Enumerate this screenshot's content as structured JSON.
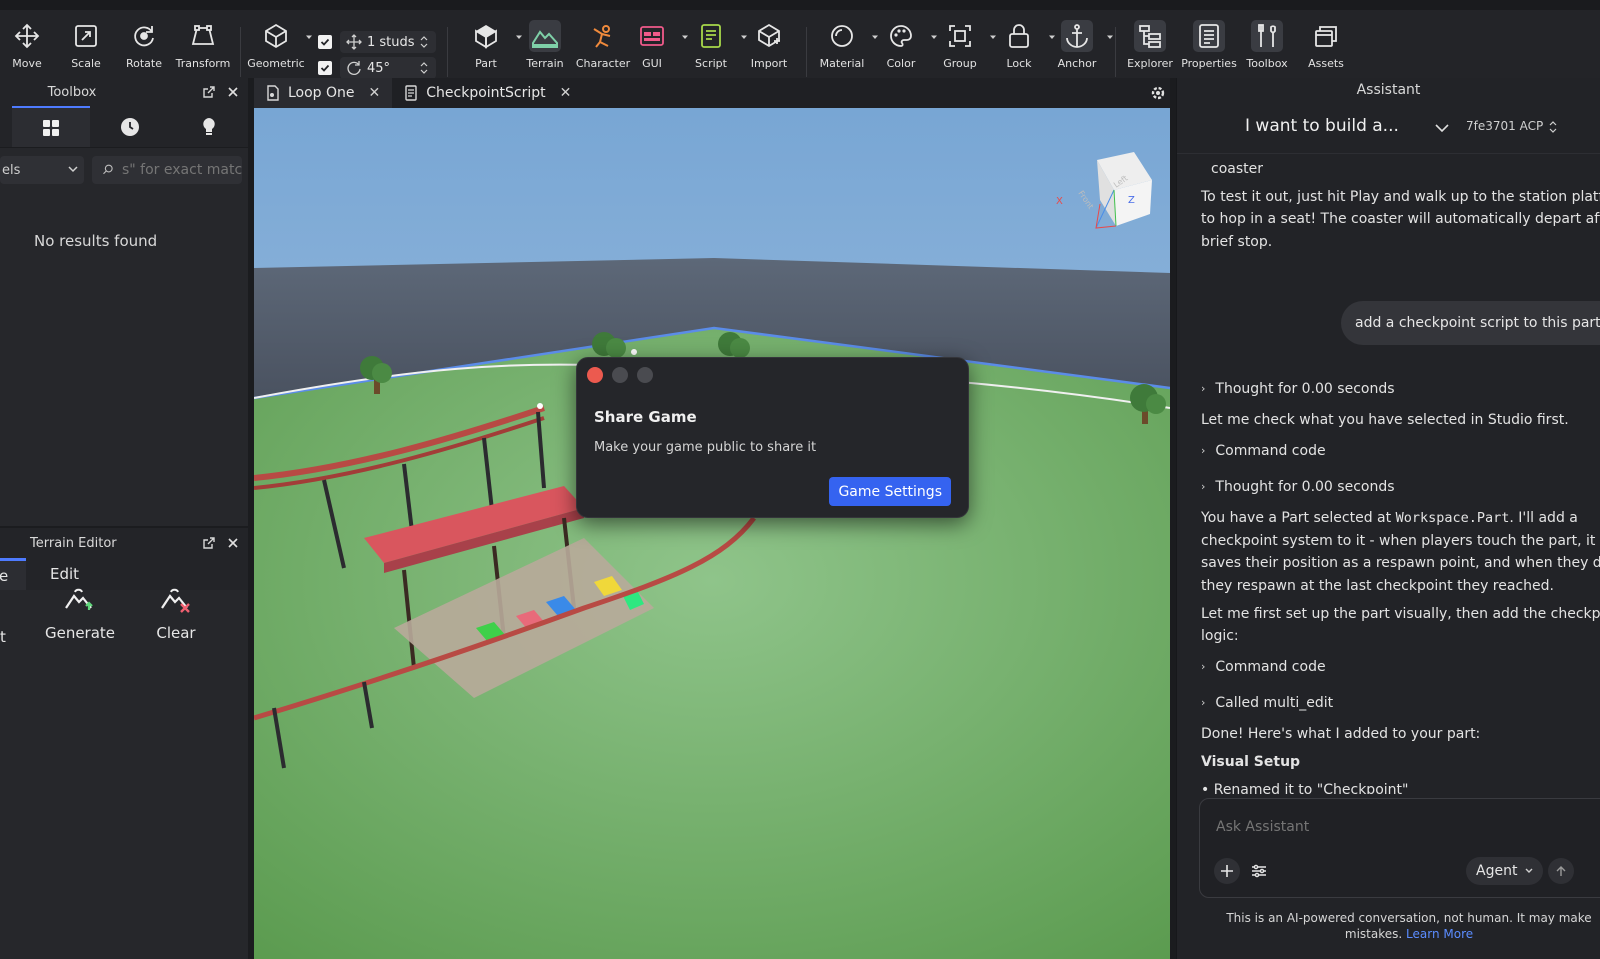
{
  "toolbar": {
    "move": "Move",
    "scale": "Scale",
    "rotate": "Rotate",
    "transform": "Transform",
    "geometric": "Geometric",
    "move_snap": "1 studs",
    "rotate_snap": "45°",
    "part": "Part",
    "terrain": "Terrain",
    "character": "Character",
    "gui": "GUI",
    "script": "Script",
    "import": "Import",
    "material": "Material",
    "color": "Color",
    "group": "Group",
    "lock": "Lock",
    "anchor": "Anchor",
    "explorer": "Explorer",
    "properties": "Properties",
    "toolbox": "Toolbox",
    "assets": "Assets"
  },
  "toolbox": {
    "title": "Toolbox",
    "category_value": "els",
    "search_placeholder": "s\" for exact matc",
    "empty_text": "No results found"
  },
  "terrain_editor": {
    "title": "Terrain Editor",
    "tab_partial": "e",
    "tab_edit": "Edit",
    "tool_partial": "t",
    "generate": "Generate",
    "clear": "Clear"
  },
  "editor_tabs": [
    {
      "label": "Loop One"
    },
    {
      "label": "CheckpointScript"
    }
  ],
  "share_dialog": {
    "title": "Share Game",
    "message": "Make your game public to share it",
    "button": "Game Settings"
  },
  "viewcube": {
    "front": "Front",
    "left": "Left",
    "x": "X",
    "z": "Z"
  },
  "assistant": {
    "title": "Assistant",
    "conversation_title": "I want to build a...",
    "model": "7fe3701 ACP",
    "msg_partial": "coaster",
    "msg_test": "To test it out, just hit Play and walk up to the station platfor",
    "msg_test_2": "to hop in a seat! The coaster will automatically depart after",
    "msg_test_3": "brief stop.",
    "user_msg": "add a checkpoint script to this part",
    "thought_1": "Thought for 0.00 seconds",
    "msg_check": "Let me check what you have selected in Studio first.",
    "command_1": "Command code",
    "thought_2": "Thought for 0.00 seconds",
    "msg_part_a": "You have a Part selected at ",
    "msg_part_code": "Workspace.Part",
    "msg_part_b": ". I'll add a",
    "msg_part_2": "checkpoint system to it - when players touch the part, it",
    "msg_part_3": "saves their position as a respawn point, and when they die,",
    "msg_part_4": "they respawn at the last checkpoint they reached.",
    "msg_setup_1": "Let me first set up the part visually, then add the checkpoin",
    "msg_setup_2": "logic:",
    "command_2": "Command code",
    "called": "Called multi_edit",
    "done": "Done! Here's what I added to your part:",
    "visual_setup": "Visual Setup",
    "bullet_1": "Renamed it to \"Checkpoint\"",
    "ask_placeholder": "Ask Assistant",
    "agent_label": "Agent",
    "disclaimer_1": "This is an AI-powered conversation, not human. It may make",
    "disclaimer_2": "mistakes.",
    "learn_more": "Learn More"
  },
  "colors": {
    "accent": "#3563f0",
    "close_red": "#ec5a4f",
    "panel_bg": "#26272b",
    "toolbar_bg": "#232428"
  }
}
